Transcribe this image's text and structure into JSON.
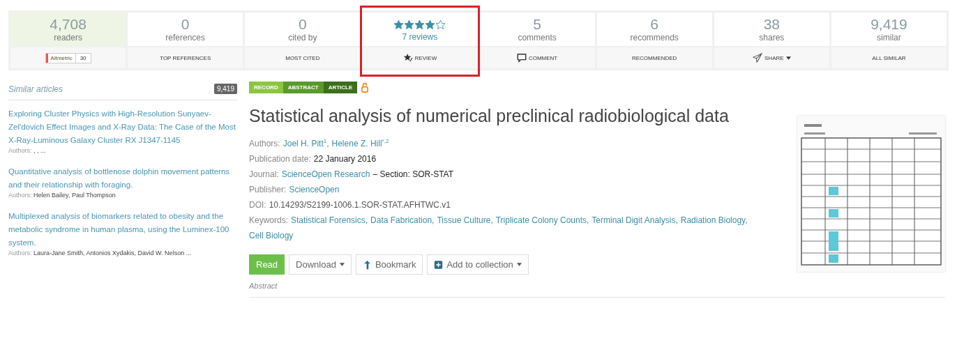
{
  "metrics": [
    {
      "kind": "count",
      "value": "4,708",
      "label": "readers",
      "selected": true,
      "highlighted": false,
      "action": {
        "kind": "altmetric",
        "label": "Altmetric",
        "score": "30"
      }
    },
    {
      "kind": "count",
      "value": "0",
      "label": "references",
      "selected": false,
      "highlighted": false,
      "action": {
        "kind": "text",
        "label": "TOP REFERENCES"
      }
    },
    {
      "kind": "count",
      "value": "0",
      "label": "cited by",
      "selected": false,
      "highlighted": false,
      "action": {
        "kind": "text",
        "label": "MOST CITED"
      }
    },
    {
      "kind": "stars",
      "stars": 4,
      "label": "7 reviews",
      "selected": false,
      "highlighted": true,
      "action": {
        "kind": "review",
        "label": "REVIEW"
      }
    },
    {
      "kind": "count",
      "value": "5",
      "label": "comments",
      "selected": false,
      "highlighted": false,
      "action": {
        "kind": "comment",
        "label": "COMMENT"
      }
    },
    {
      "kind": "count",
      "value": "6",
      "label": "recommends",
      "selected": false,
      "highlighted": false,
      "action": {
        "kind": "text",
        "label": "RECOMMENDED"
      }
    },
    {
      "kind": "count",
      "value": "38",
      "label": "shares",
      "selected": false,
      "highlighted": false,
      "action": {
        "kind": "share",
        "label": "SHARE"
      }
    },
    {
      "kind": "count",
      "value": "9,419",
      "label": "similar",
      "selected": false,
      "highlighted": false,
      "action": {
        "kind": "text",
        "label": "ALL SIMILAR"
      }
    }
  ],
  "sidebar": {
    "title": "Similar articles",
    "count": "9,419",
    "articles": [
      {
        "title": "Exploring Cluster Physics with High-Resolution Sunyaev-Zel'dovich Effect Images and X-Ray Data: The Case of the Most X-Ray-Luminous Galaxy Cluster RX J1347-1145",
        "authors_label": "Authors:",
        "authors": ", , ..."
      },
      {
        "title": "Quantitative analysis of bottlenose dolphin movement patterns and their relationship with foraging.",
        "authors_label": "Authors:",
        "authors": "Helen Bailey, Paul Thompson"
      },
      {
        "title": "Multiplexed analysis of biomarkers related to obesity and the metabolic syndrome in human plasma, using the Luminex-100 system.",
        "authors_label": "Authors:",
        "authors": "Laura-Jane Smith, Antonios Xydakis, David W. Nelson ..."
      }
    ]
  },
  "tags": [
    {
      "label": "RECORD",
      "color": "#8cc63f"
    },
    {
      "label": "ABSTRACT",
      "color": "#5a9a2a"
    },
    {
      "label": "ARTICLE",
      "color": "#3d6e1c"
    }
  ],
  "open_access": true,
  "title": "Statistical analysis of numerical preclinical radiobiological data",
  "fields": [
    {
      "kind": "links",
      "label": "Authors:",
      "links": [
        "Joel H. Pitt$^{1}$,",
        "Helene Z. Hill$^{*,2}$"
      ]
    },
    {
      "kind": "text",
      "label": "Publication date:",
      "value": "22 January 2016"
    },
    {
      "kind": "journal",
      "label": "Journal:",
      "links": [
        "ScienceOpen Research"
      ],
      "value": "– Section: SOR-STAT"
    },
    {
      "kind": "links",
      "label": "Publisher:",
      "links": [
        "ScienceOpen"
      ]
    },
    {
      "kind": "plain",
      "label": "DOI:",
      "value": "10.14293/S2199-1006.1.SOR-STAT.AFHTWC.v1"
    },
    {
      "kind": "links",
      "label": "Keywords:",
      "links": [
        "Statistical Forensics,",
        "Data Fabrication,",
        "Tissue Culture,",
        "Triplicate Colony Counts,",
        "Terminal Digit Analysis,",
        "Radiation Biology,",
        "Cell Biology"
      ]
    }
  ],
  "buttons": [
    {
      "kind": "primary",
      "label": "Read"
    },
    {
      "kind": "dropdown",
      "label": "Download"
    },
    {
      "kind": "bookmark",
      "label": "Bookmark"
    },
    {
      "kind": "collection",
      "label": "Add to collection"
    }
  ],
  "section": "Abstract"
}
